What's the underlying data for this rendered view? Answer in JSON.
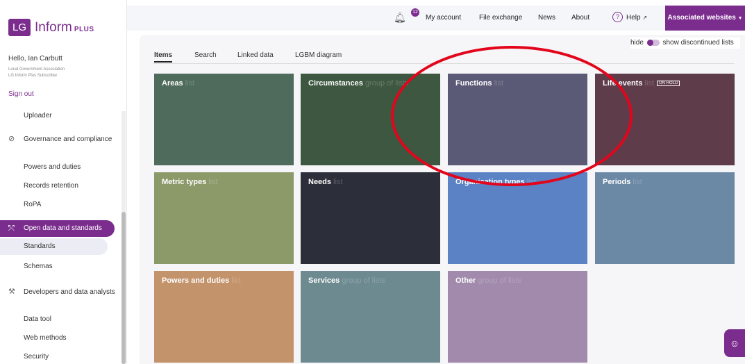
{
  "brand": {
    "logo_box": "LG",
    "logo_text": "Inform",
    "logo_plus": "PLUS",
    "accent": "#7b2d8e"
  },
  "user": {
    "hello": "Hello, Ian Carbutt",
    "org": "Local Government Association",
    "sub": "LG Inform Plus Subscriber",
    "signout": "Sign out"
  },
  "sidebar": {
    "items": [
      {
        "label": "Uploader"
      },
      {
        "label": "Governance and compliance",
        "icon": "check-circle-icon"
      },
      {
        "label": "Powers and duties"
      },
      {
        "label": "Records retention"
      },
      {
        "label": "RoPA"
      },
      {
        "label": "Open data and standards",
        "icon": "network-icon"
      },
      {
        "label": "Standards"
      },
      {
        "label": "Schemas"
      },
      {
        "label": "Developers and data analysts",
        "icon": "tools-icon"
      },
      {
        "label": "Data tool"
      },
      {
        "label": "Web methods"
      },
      {
        "label": "Security"
      }
    ]
  },
  "topnav": {
    "badge": "12",
    "my_account": "My account",
    "file_exchange": "File exchange",
    "news": "News",
    "about": "About",
    "help": "Help",
    "associated": "Associated websites"
  },
  "toggle": {
    "hide": "hide",
    "show": "show discontinued lists"
  },
  "tabs": [
    "Items",
    "Search",
    "Linked data",
    "LGBM diagram"
  ],
  "tiles": [
    {
      "title": "Areas",
      "sub": "list",
      "color": "#4f6b5b"
    },
    {
      "title": "Circumstances",
      "sub": "group of lists",
      "color": "#3d5740"
    },
    {
      "title": "Functions",
      "sub": "list",
      "color": "#5a5a76"
    },
    {
      "title": "Life events",
      "sub": "list",
      "badge": "ON HOLD",
      "color": "#5e3c4a"
    },
    {
      "title": "Metric types",
      "sub": "list",
      "color": "#8c9a6a"
    },
    {
      "title": "Needs",
      "sub": "list",
      "color": "#2c2f39"
    },
    {
      "title": "Organisation types",
      "sub": "list",
      "color": "#5b82c4"
    },
    {
      "title": "Periods",
      "sub": "list",
      "color": "#6b88a5"
    },
    {
      "title": "Powers and duties",
      "sub": "list",
      "color": "#c3936c"
    },
    {
      "title": "Services",
      "sub": "group of lists",
      "color": "#6d8a91"
    },
    {
      "title": "Other",
      "sub": "group of lists",
      "color": "#a18aac"
    }
  ]
}
